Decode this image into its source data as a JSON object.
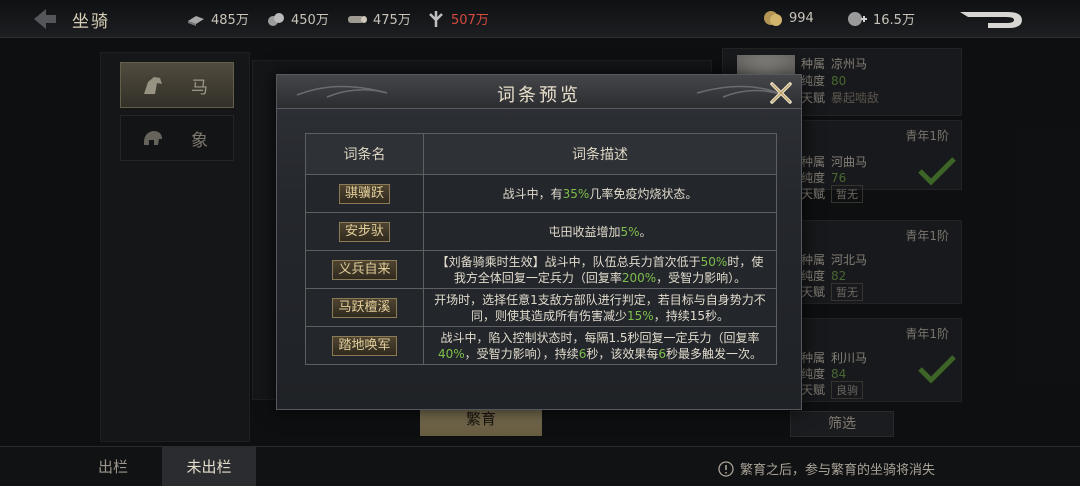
{
  "header": {
    "title": "坐骑",
    "resources": [
      {
        "icon": "iron-ingot-icon",
        "value": "485万",
        "color": "#c9c4ba"
      },
      {
        "icon": "stone-pile-icon",
        "value": "450万",
        "color": "#c9c4ba"
      },
      {
        "icon": "wood-log-icon",
        "value": "475万",
        "color": "#c9c4ba"
      },
      {
        "icon": "grain-sprout-icon",
        "value": "507万",
        "color": "#d64a3f"
      }
    ],
    "gold": "994",
    "copper": "16.5万"
  },
  "categories": [
    {
      "label": "马",
      "icon": "horse-icon",
      "active": true
    },
    {
      "label": "象",
      "icon": "elephant-icon",
      "active": false
    }
  ],
  "horses": [
    {
      "breed_label": "种属",
      "breed": "凉州马",
      "purity_label": "纯度",
      "purity": "80",
      "talent_label": "天赋",
      "talent": "暴起啮敌",
      "tier": "",
      "selected": false
    },
    {
      "breed_label": "种属",
      "breed": "河曲马",
      "purity_label": "纯度",
      "purity": "76",
      "talent_label": "天赋",
      "talent": "暂无",
      "tier": "青年1阶",
      "selected": true
    },
    {
      "breed_label": "种属",
      "breed": "河北马",
      "purity_label": "纯度",
      "purity": "82",
      "talent_label": "天赋",
      "talent": "暂无",
      "tier": "青年1阶",
      "selected": false
    },
    {
      "breed_label": "种属",
      "breed": "利川马",
      "purity_label": "纯度",
      "purity": "84",
      "talent_label": "天赋",
      "talent": "良驹",
      "tier": "青年1阶",
      "selected": true
    }
  ],
  "buttons": {
    "breed": "繁育",
    "filter": "筛选"
  },
  "bottom_tabs": [
    {
      "label": "出栏",
      "active": false
    },
    {
      "label": "未出栏",
      "active": true
    }
  ],
  "notice": "繁育之后，参与繁育的坐骑将消失",
  "modal": {
    "title": "词条预览",
    "col_name": "词条名",
    "col_desc": "词条描述",
    "rows": [
      {
        "name": "骐骥跃",
        "desc": [
          [
            "战斗中，有",
            ""
          ],
          [
            "35%",
            "hl"
          ],
          [
            "几率免疫灼烧状态。",
            ""
          ]
        ]
      },
      {
        "name": "安步驮",
        "desc": [
          [
            "屯田收益增加",
            ""
          ],
          [
            "5%",
            "hl"
          ],
          [
            "。",
            ""
          ]
        ]
      },
      {
        "name": "义兵自来",
        "desc": [
          [
            "【刘备骑乘时生效】战斗中，队伍总兵力首次低于",
            ""
          ],
          [
            "50%",
            "hl"
          ],
          [
            "时，使我方全体回复一定兵力（回复率",
            ""
          ],
          [
            "200%",
            "hl"
          ],
          [
            "，受智力影响）。",
            ""
          ]
        ]
      },
      {
        "name": "马跃檀溪",
        "desc": [
          [
            "开场时，选择任意1支敌方部队进行判定，若目标与自身势力不同，则使其造成所有伤害减少",
            ""
          ],
          [
            "15%",
            "hl"
          ],
          [
            "，持续15秒。",
            ""
          ]
        ]
      },
      {
        "name": "踏地唤军",
        "desc": [
          [
            "战斗中，陷入控制状态时，每隔1.5秒回复一定兵力（回复率",
            ""
          ],
          [
            "40%",
            "hl"
          ],
          [
            "，受智力影响），持续",
            ""
          ],
          [
            "6",
            "hl"
          ],
          [
            "秒，该效果每",
            ""
          ],
          [
            "6",
            "hl"
          ],
          [
            "秒最多触发一次。",
            ""
          ]
        ]
      }
    ]
  }
}
